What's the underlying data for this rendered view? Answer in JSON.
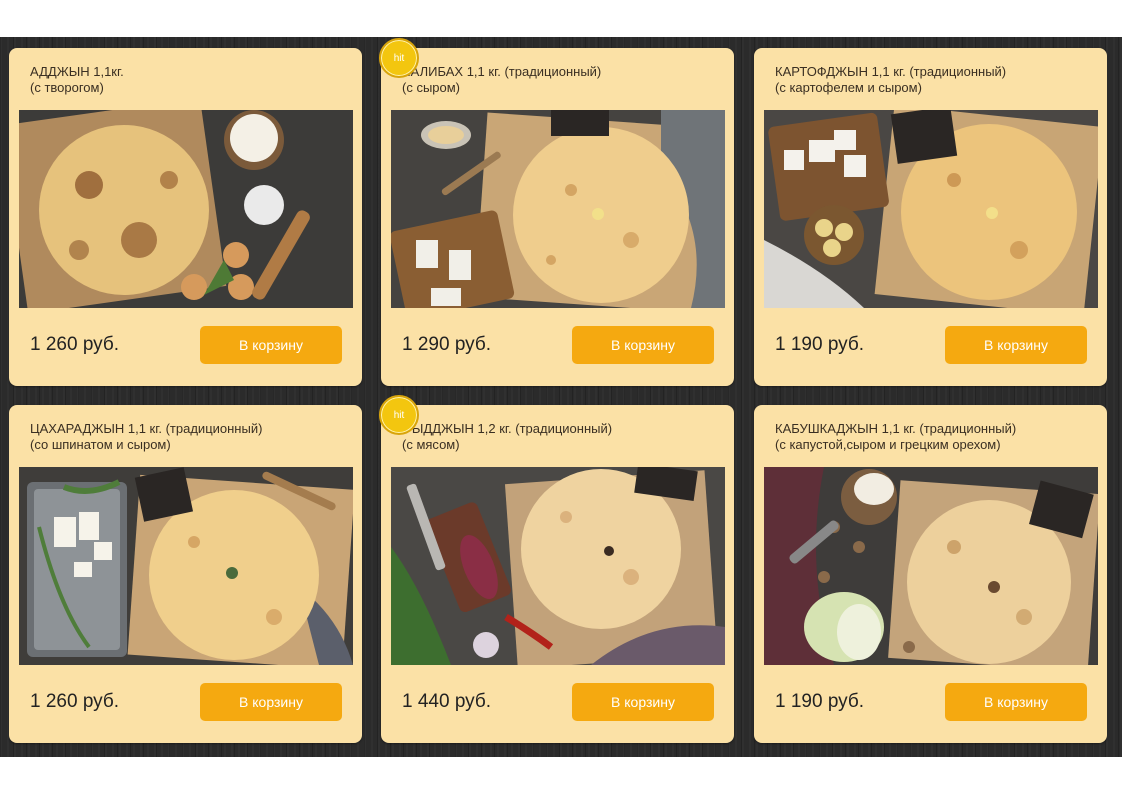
{
  "products": [
    {
      "title_line1": "АДДЖЫН 1,1кг.",
      "title_line2": "(с творогом)",
      "price": "1 260 руб.",
      "button_label": "В корзину",
      "badge": ""
    },
    {
      "title_line1": "ЧАЛИБАХ 1,1 кг. (традиционный)",
      "title_line2": "(с сыром)",
      "price": "1 290 руб.",
      "button_label": "В корзину",
      "badge": "hit"
    },
    {
      "title_line1": "КАРТОФДЖЫН 1,1 кг. (традиционный)",
      "title_line2": "(с картофелем и сыром)",
      "price": "1 190 руб.",
      "button_label": "В корзину",
      "badge": ""
    },
    {
      "title_line1": "ЦАХАРАДЖЫН 1,1 кг. (традиционный)",
      "title_line2": "(со шпинатом и сыром)",
      "price": "1 260 руб.",
      "button_label": "В корзину",
      "badge": ""
    },
    {
      "title_line1": "ФЫДДЖЫН 1,2 кг. (традиционный)",
      "title_line2": "(с мясом)",
      "price": "1 440 руб.",
      "button_label": "В корзину",
      "badge": "hit"
    },
    {
      "title_line1": "КАБУШКАДЖЫН 1,1 кг. (традиционный)",
      "title_line2": "(с капустой,сыром и грецким орехом)",
      "price": "1 190 руб.",
      "button_label": "В корзину",
      "badge": ""
    }
  ],
  "colors": {
    "card_bg": "#fbe1a6",
    "button": "#f5a910",
    "badge": "#f3c60f",
    "page_bg": "#2b2b2b"
  }
}
